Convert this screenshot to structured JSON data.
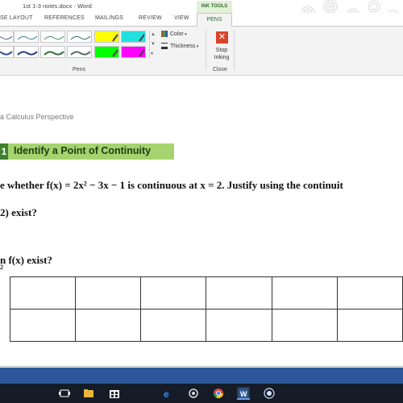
{
  "window": {
    "title": "1st 1-3 notes.docx - Word"
  },
  "ribbon": {
    "tabs": [
      "SE LAYOUT",
      "REFERENCES",
      "MAILINGS",
      "REVIEW",
      "VIEW"
    ],
    "contextual_group": "INK TOOLS",
    "active_tab": "PENS",
    "pens_group_label": "Pens",
    "color_label": "Color",
    "thickness_label": "Thickness",
    "stop_inking_label": "Stop Inking",
    "close_group_label": "Close",
    "colors": {
      "accent_green": "#2f6f2f",
      "stop_red": "#d9442c",
      "highlight_yellow": "#ffff00",
      "highlight_green": "#00ff00",
      "highlight_magenta": "#ff00ff"
    }
  },
  "document": {
    "subtitle": "a Calculus Perspective",
    "example_number": "1",
    "example_title": "Identify a Point of Continuity",
    "line1": "e whether f(x) = 2x² − 3x − 1 is continuous at x = 2. Justify using the continuit",
    "line2": "2) exist?",
    "line3": "n f(x) exist?",
    "lim_subscript": "2",
    "banner_color": "#a5d46f"
  },
  "statusbar": {
    "color": "#2b579a"
  },
  "taskbar": {
    "icons": [
      "task-view-icon",
      "file-explorer-icon",
      "store-icon",
      "edge-icon",
      "bluetooth-icon",
      "chrome-icon",
      "word-icon",
      "record-icon"
    ]
  }
}
